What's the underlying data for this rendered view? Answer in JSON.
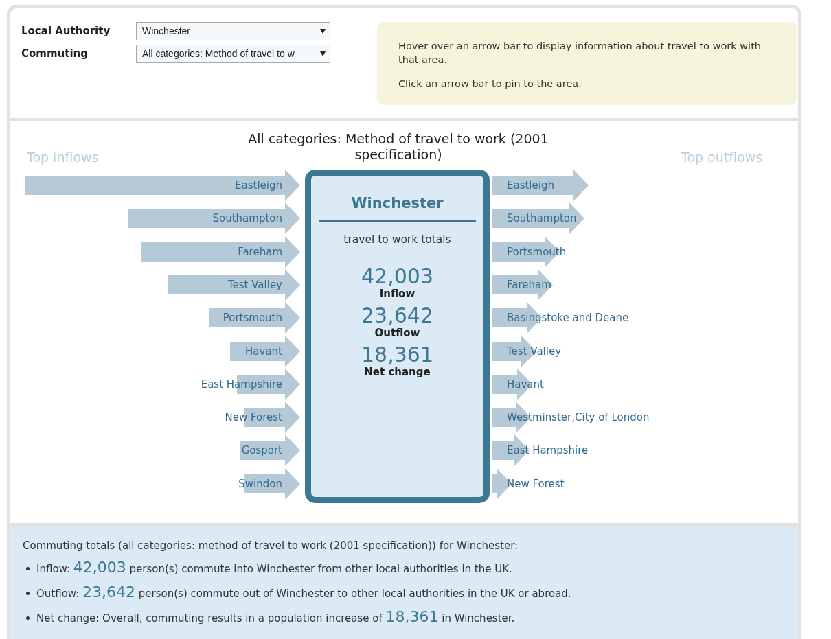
{
  "controls": [
    {
      "label": "Local Authority",
      "value": "Winchester"
    },
    {
      "label": "Commuting",
      "value": "All categories: Method of travel to w"
    }
  ],
  "info": [
    "Hover over an arrow bar to display information about travel to work with that area.",
    "Click an arrow bar to pin to the area."
  ],
  "chart": {
    "title": "All categories: Method of travel to work (2001 specification)",
    "inflows_heading": "Top inflows",
    "outflows_heading": "Top outflows",
    "inflows": [
      {
        "name": "Eastleigh",
        "level": 1.0
      },
      {
        "name": "Southampton",
        "level": 0.625
      },
      {
        "name": "Fareham",
        "level": 0.58
      },
      {
        "name": "Test Valley",
        "level": 0.48
      },
      {
        "name": "Portsmouth",
        "level": 0.33
      },
      {
        "name": "Havant",
        "level": 0.255
      },
      {
        "name": "East Hampshire",
        "level": 0.23
      },
      {
        "name": "New Forest",
        "level": 0.205
      },
      {
        "name": "Gosport",
        "level": 0.22
      },
      {
        "name": "Swindon",
        "level": 0.205
      }
    ],
    "outflows": [
      {
        "name": "Eastleigh",
        "level": 0.35
      },
      {
        "name": "Southampton",
        "level": 0.335
      },
      {
        "name": "Portsmouth",
        "level": 0.245
      },
      {
        "name": "Fareham",
        "level": 0.22
      },
      {
        "name": "Basingstoke and Deane",
        "level": 0.18
      },
      {
        "name": "Test Valley",
        "level": 0.16
      },
      {
        "name": "Havant",
        "level": 0.145
      },
      {
        "name": "Westminster,City of London",
        "level": 0.14
      },
      {
        "name": "East Hampshire",
        "level": 0.135
      },
      {
        "name": "New Forest",
        "level": 0.07
      }
    ],
    "center": {
      "name": "Winchester",
      "subtitle": "travel to work totals",
      "totals": [
        {
          "value": "42,003",
          "label": "Inflow"
        },
        {
          "value": "23,642",
          "label": "Outflow"
        },
        {
          "value": "18,361",
          "label": "Net change"
        }
      ]
    }
  },
  "summary": {
    "heading": "Commuting totals (all categories: method of travel to work (2001 specification)) for Winchester:",
    "bullets": [
      {
        "before": "Inflow:",
        "number": "42,003",
        "after": "person(s) commute into Winchester from other local authorities in the UK."
      },
      {
        "before": "Outflow:",
        "number": "23,642",
        "after": "person(s) commute out of Winchester to other local authorities in the UK or abroad."
      },
      {
        "before": "Net change: Overall, commuting results in a population increase of",
        "number": "18,361",
        "after": "in Winchester."
      }
    ]
  }
}
